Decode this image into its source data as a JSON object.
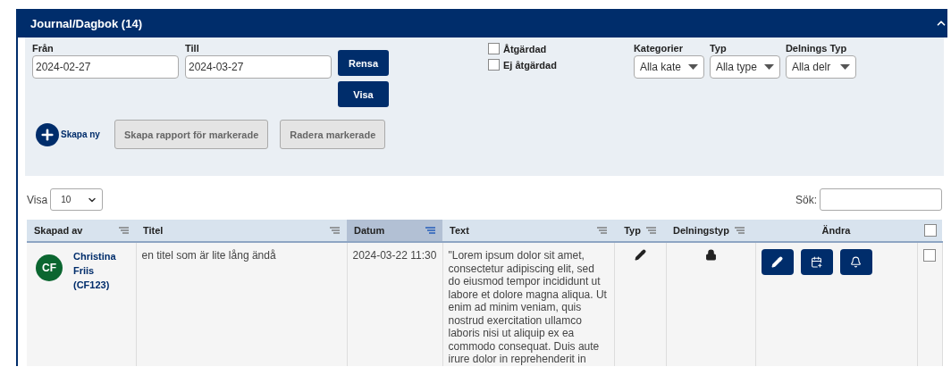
{
  "panel": {
    "title": "Journal/Dagbok (14)",
    "expanded": true
  },
  "filters": {
    "dates": [
      {
        "label": "Från",
        "value": "2024-02-27"
      },
      {
        "label": "Till",
        "value": "2024-03-27"
      }
    ],
    "buttons": [
      "Rensa",
      "Visa"
    ],
    "checkboxes": [
      {
        "label": "Åtgärdad",
        "checked": false
      },
      {
        "label": "Ej åtgärdad",
        "checked": false
      }
    ],
    "dropdowns": [
      {
        "label": "Kategorier",
        "value": "Alla kate"
      },
      {
        "label": "Typ",
        "value": "Alla type"
      },
      {
        "label": "Delnings Typ",
        "value": "Alla delr"
      }
    ]
  },
  "actions": {
    "create": "Skapa ny",
    "buttons": [
      {
        "label": "Skapa rapport för markerade",
        "disabled": true
      },
      {
        "label": "Radera markerade",
        "disabled": true
      }
    ]
  },
  "page_size": {
    "label": "Visa",
    "value": "10"
  },
  "search": {
    "label": "Sök:"
  },
  "table": {
    "columns": [
      {
        "label": "Skapad av",
        "selected": false
      },
      {
        "label": "Titel",
        "selected": false
      },
      {
        "label": "Datum",
        "selected": true
      },
      {
        "label": "Text",
        "selected": false
      },
      {
        "label": "Typ",
        "selected": false
      },
      {
        "label": "Delningstyp",
        "selected": false
      },
      {
        "label": "Ändra",
        "kind": "plain"
      }
    ],
    "select_all": {
      "checked": false
    },
    "rows": [
      {
        "initials": "CF",
        "color": "#0b6630",
        "author": "Christina Friis (CF123)",
        "title": "en titel som är lite lång ändå",
        "date": "2024-03-22 11:30",
        "text": "\"Lorem ipsum dolor sit amet, consectetur adipiscing elit, sed do eiusmod tempor incididunt ut labore et dolore magna aliqua. Ut enim ad minim veniam, quis nostrud exercitation ullamco laboris nisi ut aliquip ex ea commodo consequat. Duis aute irure dolor in reprehenderit in",
        "checked": false
      }
    ]
  }
}
